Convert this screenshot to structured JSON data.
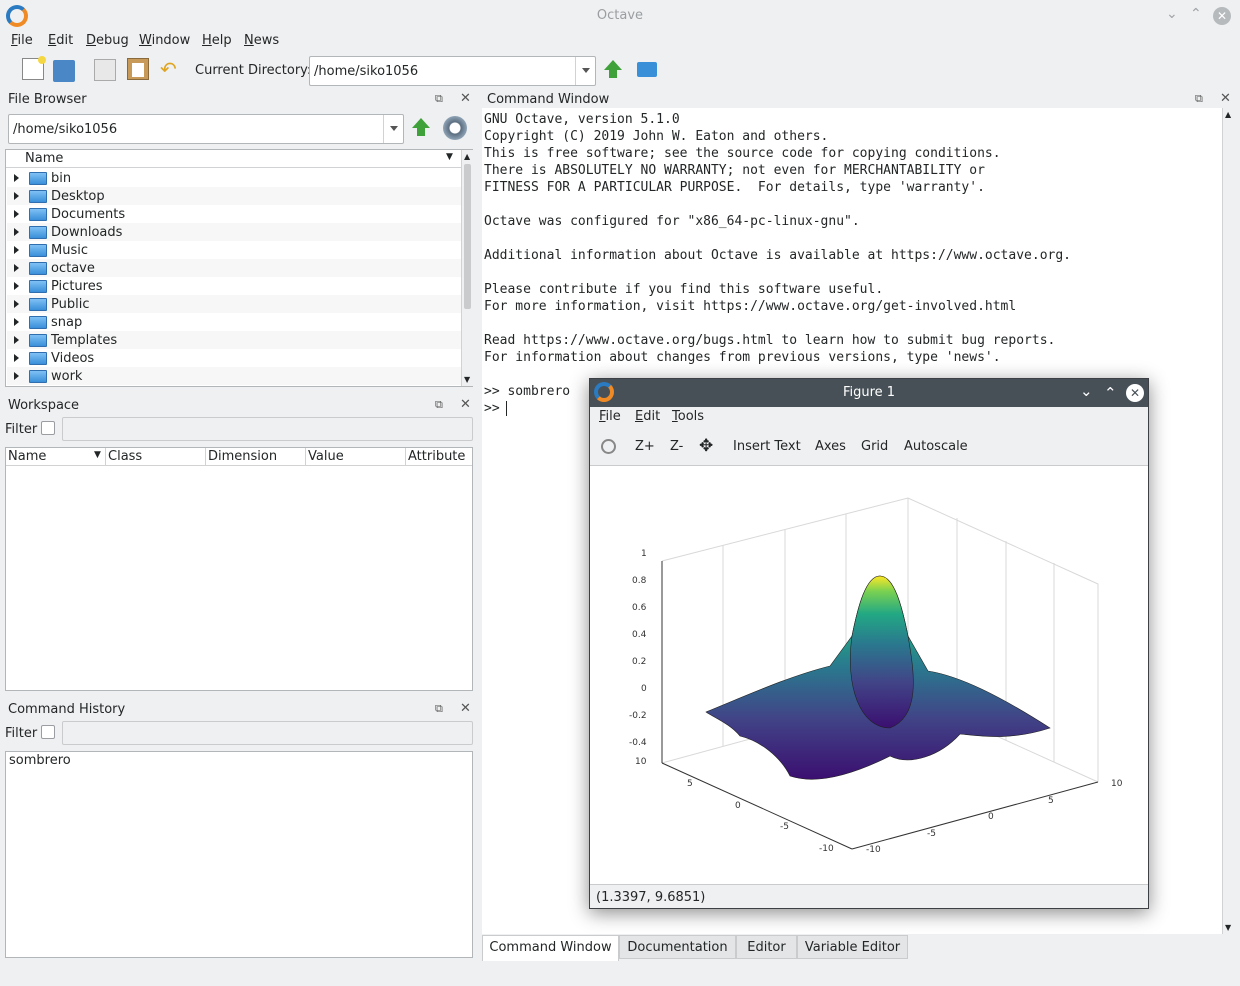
{
  "window": {
    "title": "Octave"
  },
  "menubar": [
    "File",
    "Edit",
    "Debug",
    "Window",
    "Help",
    "News"
  ],
  "toolbar": {
    "current_dir_label": "Current Directory:",
    "current_dir_value": "/home/siko1056"
  },
  "file_browser": {
    "title": "File Browser",
    "path": "/home/siko1056",
    "column": "Name",
    "items": [
      "bin",
      "Desktop",
      "Documents",
      "Downloads",
      "Music",
      "octave",
      "Pictures",
      "Public",
      "snap",
      "Templates",
      "Videos",
      "work"
    ]
  },
  "workspace": {
    "title": "Workspace",
    "filter_label": "Filter",
    "columns": [
      "Name",
      "Class",
      "Dimension",
      "Value",
      "Attribute"
    ]
  },
  "history": {
    "title": "Command History",
    "filter_label": "Filter",
    "items": [
      "sombrero"
    ]
  },
  "command_window": {
    "title": "Command Window",
    "lines": [
      "GNU Octave, version 5.1.0",
      "Copyright (C) 2019 John W. Eaton and others.",
      "This is free software; see the source code for copying conditions.",
      "There is ABSOLUTELY NO WARRANTY; not even for MERCHANTABILITY or",
      "FITNESS FOR A PARTICULAR PURPOSE.  For details, type 'warranty'.",
      "",
      "Octave was configured for \"x86_64-pc-linux-gnu\".",
      "",
      "Additional information about Octave is available at https://www.octave.org.",
      "",
      "Please contribute if you find this software useful.",
      "For more information, visit https://www.octave.org/get-involved.html",
      "",
      "Read https://www.octave.org/bugs.html to learn how to submit bug reports.",
      "For information about changes from previous versions, type 'news'.",
      "",
      ">> sombrero",
      ">> "
    ]
  },
  "tabs": [
    "Command Window",
    "Documentation",
    "Editor",
    "Variable Editor"
  ],
  "figure": {
    "title": "Figure 1",
    "menu": [
      "File",
      "Edit",
      "Tools"
    ],
    "toolbar": [
      "Z+",
      "Z-",
      "Insert Text",
      "Axes",
      "Grid",
      "Autoscale"
    ],
    "status": "(1.3397, 9.6851)",
    "z_ticks": [
      "1",
      "0.8",
      "0.6",
      "0.4",
      "0.2",
      "0",
      "-0.2",
      "-0.4"
    ],
    "y_ticks": [
      "10",
      "5",
      "0",
      "-5",
      "-10"
    ],
    "x_ticks": [
      "-10",
      "-5",
      "0",
      "5",
      "10"
    ]
  },
  "colors": {
    "accent": "#3daee9",
    "folder": "#3a8fd9",
    "green_arrow": "#3fa13a"
  }
}
